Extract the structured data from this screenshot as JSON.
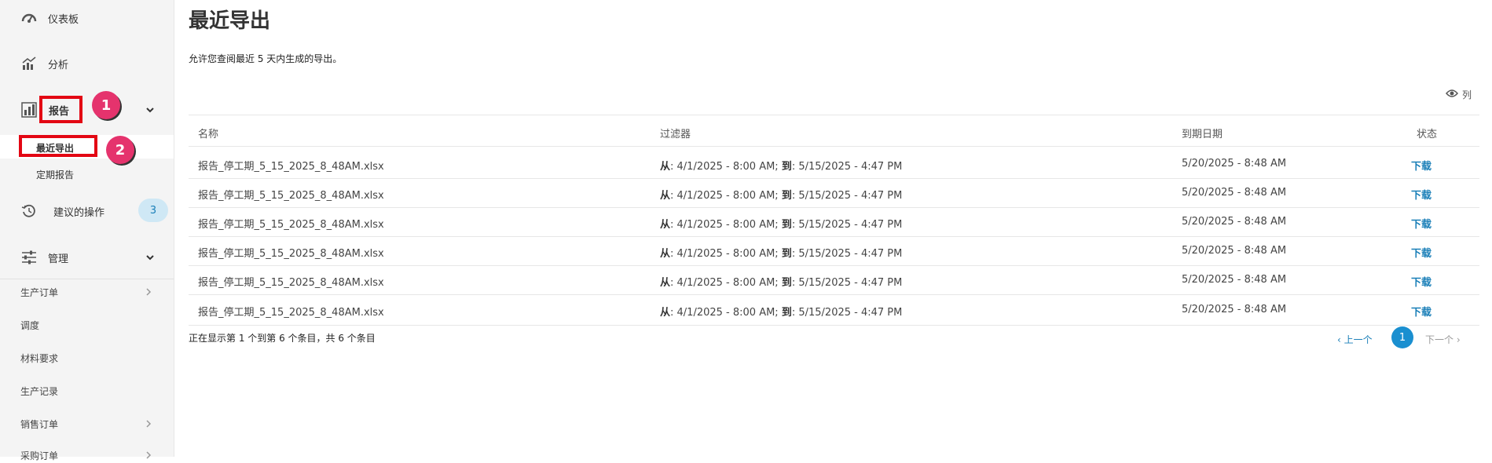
{
  "sidebar": {
    "dashboard": "仪表板",
    "analytics": "分析",
    "reports": "报告",
    "reports_sub": [
      "最近导出",
      "定期报告"
    ],
    "suggested_actions": "建议的操作",
    "suggested_count": "3",
    "manage": "管理",
    "manage_items": [
      "生产订单",
      "调度",
      "材料要求",
      "生产记录",
      "销售订单",
      "采购订单"
    ]
  },
  "callouts": [
    "1",
    "2"
  ],
  "main": {
    "title": "最近导出",
    "description": "允许您查阅最近 5 天内生成的导出。",
    "columns_label": "列",
    "headers": [
      "名称",
      "过滤器",
      "到期日期",
      "状态"
    ],
    "rows": [
      {
        "name": "报告_停工期_5_15_2025_8_48AM.xlsx",
        "from_label": "从",
        "from": ": 4/1/2025 - 8:00 AM; ",
        "to_label": "到",
        "to": ": 5/15/2025 - 4:47 PM",
        "expires": "5/20/2025 - 8:48 AM",
        "status": "下载"
      },
      {
        "name": "报告_停工期_5_15_2025_8_48AM.xlsx",
        "from_label": "从",
        "from": ": 4/1/2025 - 8:00 AM; ",
        "to_label": "到",
        "to": ": 5/15/2025 - 4:47 PM",
        "expires": "5/20/2025 - 8:48 AM",
        "status": "下载"
      },
      {
        "name": "报告_停工期_5_15_2025_8_48AM.xlsx",
        "from_label": "从",
        "from": ": 4/1/2025 - 8:00 AM; ",
        "to_label": "到",
        "to": ": 5/15/2025 - 4:47 PM",
        "expires": "5/20/2025 - 8:48 AM",
        "status": "下载"
      },
      {
        "name": "报告_停工期_5_15_2025_8_48AM.xlsx",
        "from_label": "从",
        "from": ": 4/1/2025 - 8:00 AM; ",
        "to_label": "到",
        "to": ": 5/15/2025 - 4:47 PM",
        "expires": "5/20/2025 - 8:48 AM",
        "status": "下载"
      },
      {
        "name": "报告_停工期_5_15_2025_8_48AM.xlsx",
        "from_label": "从",
        "from": ": 4/1/2025 - 8:00 AM; ",
        "to_label": "到",
        "to": ": 5/15/2025 - 4:47 PM",
        "expires": "5/20/2025 - 8:48 AM",
        "status": "下载"
      },
      {
        "name": "报告_停工期_5_15_2025_8_48AM.xlsx",
        "from_label": "从",
        "from": ": 4/1/2025 - 8:00 AM; ",
        "to_label": "到",
        "to": ": 5/15/2025 - 4:47 PM",
        "expires": "5/20/2025 - 8:48 AM",
        "status": "下载"
      }
    ],
    "info": "正在显示第 1 个到第 6 个条目，共 6 个条目",
    "pager": {
      "prev": "‹ 上一个",
      "current": "1",
      "next": "下一个 ›"
    }
  },
  "colors": {
    "highlight": "#e30613",
    "callout": "#e5336d",
    "link": "#1a7fb8"
  }
}
